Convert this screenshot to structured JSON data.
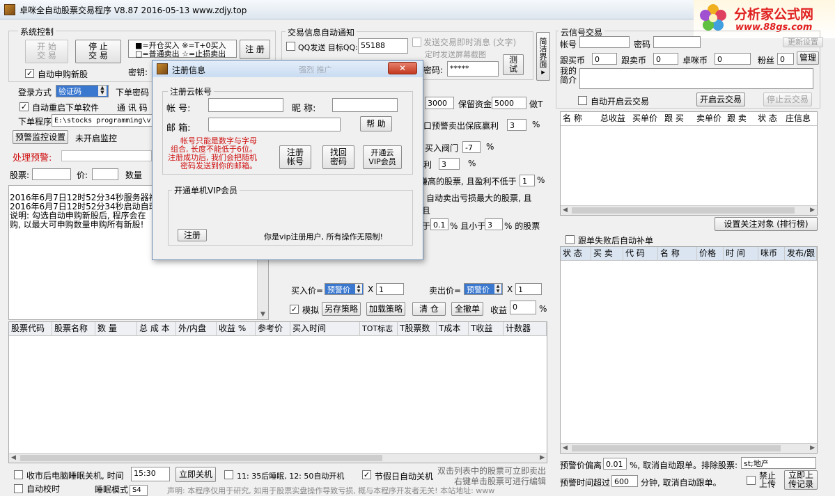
{
  "window": {
    "title": "卓咪全自动股票交易程序 V8.87  2016-05-13  www.zdjy.top",
    "logo_text": "分析家公式网",
    "logo_url": "www.88gs.com"
  },
  "system_control": {
    "group_label": "系统控制",
    "start_button": "开 始\n交 易",
    "stop_button": "停 止\n交 易",
    "mode_line1": "■=开仓买入 ※=T+0买入",
    "mode_line2": "□=普通卖出 ☆=止损卖出",
    "register_button": "注 册",
    "auto_ipo_label": "自动申购新股",
    "secret_key_label": "密钥:",
    "login_mode_label": "登录方式",
    "login_mode_value": "验证码",
    "order_password_label": "下单密码",
    "auto_restart_label": "自动重启下单软件",
    "comm_label": "通 讯 码",
    "order_program_label": "下单程序",
    "order_program_value": "E:\\stocks programming\\v",
    "alert_settings_button": "预警监控设置",
    "monitor_status": "未开启监控",
    "alert_processing_label": "处理预警:",
    "stock_label": "股票:",
    "price_label": "价:",
    "qty_label": "数量"
  },
  "log": {
    "lines": [
      "2016年6月7日12时52分34秒服务器初始",
      "2016年6月7日12时52分34秒启动自动交",
      "说明: 勾选自动申购新股后, 程序会在",
      "购, 以最大可申购数量申购所有新股!"
    ]
  },
  "notify": {
    "group_label": "交易信息自动通知",
    "qq_label": "QQ发送 目标QQ:",
    "qq_value": "55188",
    "instant_msg_label": "发送交易即时消息 (文字)",
    "screenshot_label": "定时发送屏幕截图",
    "password_label": "密码:",
    "password_value": "*****",
    "test_button": "测\n试",
    "simple_interface_button": "简\n洁\n界\n面\n▸"
  },
  "strategy": {
    "funds_value": "3000",
    "reserve_label": "保留资金",
    "reserve_value": "5000",
    "reserve_suffix": "做T",
    "alert_sell_label": "口预警卖出保底赢利",
    "alert_sell_value": "3",
    "alert_sell_unit": "%",
    "buy_threshold_label": "买入阀门",
    "buy_threshold_value": "-7",
    "buy_threshold_unit": "%",
    "profit_label": "利",
    "profit_value": "3",
    "profit_unit": "%",
    "highest_label": "赚高的股票, 且盈利不低于",
    "highest_value": "1",
    "highest_unit": "%",
    "loss_label_1": "自动卖出亏损最大的股票, 且",
    "loss_label_2": "且",
    "range_prefix": "于",
    "range_min": "0.1",
    "range_mid": "% 且小于",
    "range_max": "3",
    "range_suffix": "% 的股票",
    "buy_price_label": "买入价=",
    "buy_price_select": "预警价",
    "buy_mult": "1",
    "sell_price_label": "卖出价=",
    "sell_price_select": "预警价",
    "sell_mult": "1",
    "times_sign": "X",
    "simulate_label": "模拟",
    "save_strategy_button": "另存策略",
    "load_strategy_button": "加载策略",
    "clear_button": "清 仓",
    "cancel_all_button": "全撤单",
    "income_label": "收益",
    "income_value": "0",
    "income_unit": "%"
  },
  "holdings_table": {
    "columns": [
      "股票代码",
      "股票名称",
      "数  量",
      "总 成 本",
      "外/内盘",
      "收益  %",
      "参考价",
      "买入时间",
      "TOT标志",
      "T股票数",
      "T成本",
      "T收益",
      "计数器"
    ]
  },
  "bottom_bar": {
    "shutdown_label": "收市后电脑睡眠关机, 时间",
    "shutdown_time": "15:30",
    "shutdown_now_button": "立即关机",
    "sleep_label": "11: 35后睡眠, 12: 50自动开机",
    "holiday_label": "节假日自动关机",
    "auto_clock_label": "自动校时",
    "sleep_mode_label": "睡眠模式",
    "sleep_mode_value": "S4",
    "hint_line1": "双击列表中的股票可立即卖出",
    "hint_line2": "右键单击股票可进行编辑",
    "disclaimer": "声明: 本程序仅用于研究, 如用于股票实盘操作导致亏损, 概与本程序开发者无关! 本站地址: www"
  },
  "cloud": {
    "group_label": "云信号交易",
    "account_label": "帐号",
    "password_label": "密码",
    "change_settings_button": "更新设置",
    "follow_buy_label": "跟买币",
    "follow_buy_value": "0",
    "follow_sell_label": "跟卖币",
    "follow_sell_value": "0",
    "zhuomi_label": "卓咪币",
    "zhuomi_value": "0",
    "fans_label": "粉丝",
    "fans_value": "0",
    "manage_button": "管理",
    "intro_label": "我的\n简介",
    "auto_cloud_label": "自动开启云交易",
    "start_cloud_button": "开启云交易",
    "stop_cloud_button": "停止云交易",
    "signal_columns": [
      "名 称",
      "总收益",
      "买单价",
      "跟 买",
      "卖单价",
      "跟 卖",
      "状 态",
      "庄信息"
    ],
    "set_focus_button": "设置关注对象 (排行榜)",
    "auto_refill_label": "跟单失败后自动补单",
    "follow_columns": [
      "状 态",
      "买 卖",
      "代 码",
      "名 称",
      "价格",
      "时 间",
      "咪币",
      "发布/跟"
    ],
    "deviation_label": "预警价偏离",
    "deviation_value": "0.01",
    "deviation_suffix": "%, 取消自动跟单。排除股票:",
    "exclude_value": "st;地产",
    "timeout_label": "预警时间超过",
    "timeout_value": "600",
    "timeout_suffix": "分钟, 取消自动跟单。",
    "ban_upload_label": "禁止\n上传",
    "upload_now_button": "立即上\n传记录"
  },
  "dialog": {
    "title": "注册信息",
    "blurred_bg": "强烈 推广",
    "cloud_group_label": "注册云帐号",
    "account_label": "帐 号:",
    "nickname_label": "昵 称:",
    "email_label": "邮 箱:",
    "help_button": "帮 助",
    "note": "帐号只能是数字与字母\n组合, 长度不能低于6位。\n注册成功后, 我们会把随机\n密码发送到你的邮箱。",
    "register_account_button": "注册\n帐号",
    "recover_password_button": "找回\n密码",
    "vip_button": "开通云\nVIP会员",
    "vip_group_label": "开通单机VIP会员",
    "register_button": "注册",
    "vip_status": "你是vip注册用户, 所有操作无限制!"
  }
}
